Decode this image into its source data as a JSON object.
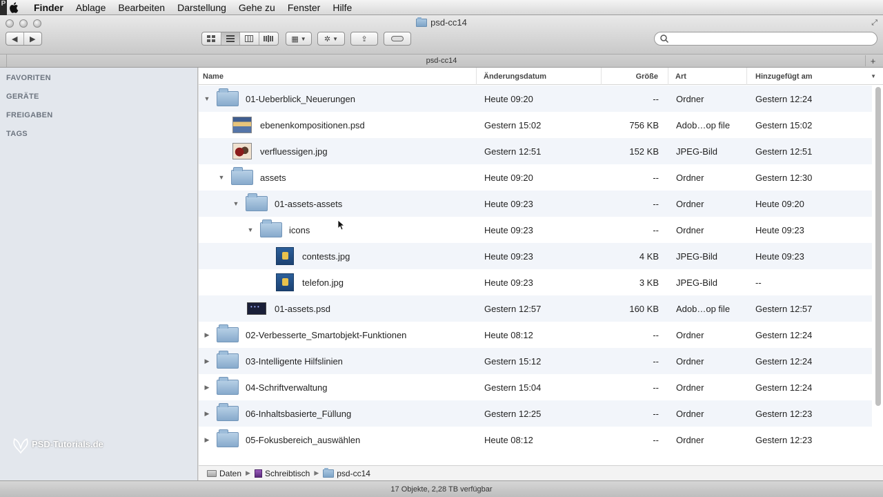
{
  "menubar": {
    "app_name": "Finder",
    "items": [
      "Ablage",
      "Bearbeiten",
      "Darstellung",
      "Gehe zu",
      "Fenster",
      "Hilfe"
    ]
  },
  "window": {
    "title": "psd-cc14",
    "tab_title": "psd-cc14",
    "search_placeholder": ""
  },
  "toolbar": {
    "view_modes": [
      "icon-view",
      "list-view",
      "column-view",
      "coverflow-view"
    ],
    "active_view": "list-view"
  },
  "sidebar": {
    "sections": [
      "FAVORITEN",
      "GERÄTE",
      "FREIGABEN",
      "TAGS"
    ],
    "watermark": "PSD-Tutorials.de"
  },
  "columns": {
    "name": "Name",
    "date": "Änderungsdatum",
    "size": "Größe",
    "kind": "Art",
    "added": "Hinzugefügt am"
  },
  "rows": [
    {
      "indent": 0,
      "disclosure": "open",
      "icon": "folder",
      "name": "01-Ueberblick_Neuerungen",
      "date": "Heute 09:20",
      "size": "--",
      "kind": "Ordner",
      "added": "Gestern 12:24"
    },
    {
      "indent": 1,
      "disclosure": "none",
      "icon": "psd1",
      "name": "ebenenkompositionen.psd",
      "date": "Gestern 15:02",
      "size": "756 KB",
      "kind": "Adob…op file",
      "added": "Gestern 15:02"
    },
    {
      "indent": 1,
      "disclosure": "none",
      "icon": "jpg1",
      "name": "verfluessigen.jpg",
      "date": "Gestern 12:51",
      "size": "152 KB",
      "kind": "JPEG-Bild",
      "added": "Gestern 12:51"
    },
    {
      "indent": 1,
      "disclosure": "open",
      "icon": "folder",
      "name": "assets",
      "date": "Heute 09:20",
      "size": "--",
      "kind": "Ordner",
      "added": "Gestern 12:30"
    },
    {
      "indent": 2,
      "disclosure": "open",
      "icon": "folder",
      "name": "01-assets-assets",
      "date": "Heute 09:23",
      "size": "--",
      "kind": "Ordner",
      "added": "Heute 09:20"
    },
    {
      "indent": 3,
      "disclosure": "open",
      "icon": "folder",
      "name": "icons",
      "date": "Heute 09:23",
      "size": "--",
      "kind": "Ordner",
      "added": "Heute 09:23"
    },
    {
      "indent": 4,
      "disclosure": "none",
      "icon": "icon-blue",
      "name": "contests.jpg",
      "date": "Heute 09:23",
      "size": "4 KB",
      "kind": "JPEG-Bild",
      "added": "Heute 09:23"
    },
    {
      "indent": 4,
      "disclosure": "none",
      "icon": "icon-blue",
      "name": "telefon.jpg",
      "date": "Heute 09:23",
      "size": "3 KB",
      "kind": "JPEG-Bild",
      "added": "--"
    },
    {
      "indent": 2,
      "disclosure": "none",
      "icon": "psd2",
      "name": "01-assets.psd",
      "date": "Gestern 12:57",
      "size": "160 KB",
      "kind": "Adob…op file",
      "added": "Gestern 12:57"
    },
    {
      "indent": 0,
      "disclosure": "closed",
      "icon": "folder",
      "name": "02-Verbesserte_Smartobjekt-Funktionen",
      "date": "Heute 08:12",
      "size": "--",
      "kind": "Ordner",
      "added": "Gestern 12:24"
    },
    {
      "indent": 0,
      "disclosure": "closed",
      "icon": "folder",
      "name": "03-Intelligente Hilfslinien",
      "date": "Gestern 15:12",
      "size": "--",
      "kind": "Ordner",
      "added": "Gestern 12:24"
    },
    {
      "indent": 0,
      "disclosure": "closed",
      "icon": "folder",
      "name": "04-Schriftverwaltung",
      "date": "Gestern 15:04",
      "size": "--",
      "kind": "Ordner",
      "added": "Gestern 12:24"
    },
    {
      "indent": 0,
      "disclosure": "closed",
      "icon": "folder",
      "name": "06-Inhaltsbasierte_Füllung",
      "date": "Gestern 12:25",
      "size": "--",
      "kind": "Ordner",
      "added": "Gestern 12:23"
    },
    {
      "indent": 0,
      "disclosure": "closed",
      "icon": "folder",
      "name": "05-Fokusbereich_auswählen",
      "date": "Heute 08:12",
      "size": "--",
      "kind": "Ordner",
      "added": "Gestern 12:23"
    }
  ],
  "pathbar": [
    "Daten",
    "Schreibtisch",
    "psd-cc14"
  ],
  "status": "17 Objekte, 2,28 TB verfügbar"
}
